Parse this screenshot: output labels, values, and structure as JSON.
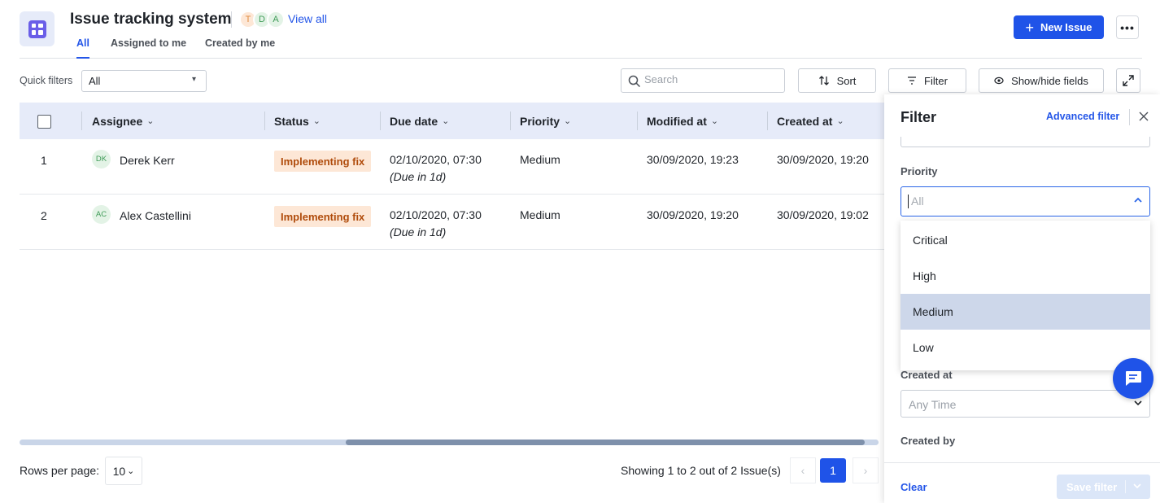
{
  "header": {
    "title": "Issue tracking system",
    "avatars": [
      "T",
      "D",
      "A"
    ],
    "view_all": "View all",
    "new_issue": "New Issue",
    "more_icon": "ellipsis-icon"
  },
  "tabs": [
    {
      "label": "All",
      "active": true
    },
    {
      "label": "Assigned to me",
      "active": false
    },
    {
      "label": "Created by me",
      "active": false
    }
  ],
  "toolbar": {
    "quick_filters_label": "Quick filters",
    "quick_filters_value": "All",
    "search_placeholder": "Search",
    "sort_label": "Sort",
    "filter_label": "Filter",
    "fields_label": "Show/hide fields"
  },
  "table": {
    "columns": [
      "Assignee",
      "Status",
      "Due date",
      "Priority",
      "Modified at",
      "Created at"
    ],
    "rows": [
      {
        "index": "1",
        "initials": "DK",
        "assignee": "Derek Kerr",
        "status": "Implementing fix",
        "due_date": "02/10/2020, 07:30",
        "due_note": "(Due  in 1d)",
        "priority": "Medium",
        "modified_at": "30/09/2020, 19:23",
        "created_at": "30/09/2020, 19:20"
      },
      {
        "index": "2",
        "initials": "AC",
        "assignee": "Alex Castellini",
        "status": "Implementing fix",
        "due_date": "02/10/2020, 07:30",
        "due_note": "(Due  in 1d)",
        "priority": "Medium",
        "modified_at": "30/09/2020, 19:20",
        "created_at": "30/09/2020, 19:02"
      }
    ]
  },
  "pagination": {
    "rows_per_page_label": "Rows per page:",
    "rows_per_page_value": "10",
    "showing": "Showing 1 to 2 out of 2 Issue(s)",
    "current_page": "1"
  },
  "filter_panel": {
    "title": "Filter",
    "advanced": "Advanced filter",
    "priority_label": "Priority",
    "priority_placeholder": "All",
    "priority_options": [
      "Critical",
      "High",
      "Medium",
      "Low"
    ],
    "selected_option": "Medium",
    "created_at_label": "Created at",
    "created_at_placeholder": "Any Time",
    "created_by_label": "Created by",
    "clear": "Clear",
    "save": "Save filter"
  },
  "colors": {
    "accent": "#1f53e8",
    "header_bg": "#e6ebf9",
    "badge_bg": "#fde7d6",
    "badge_text": "#b04c0c"
  }
}
